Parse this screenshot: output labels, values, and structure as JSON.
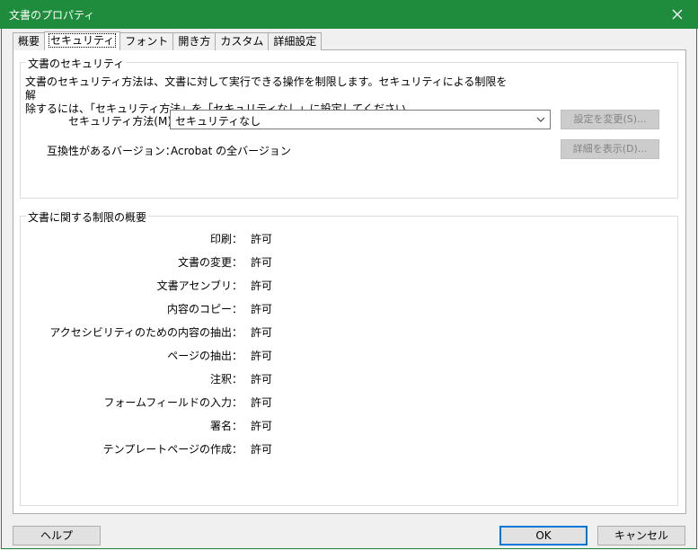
{
  "window": {
    "title": "文書のプロパティ"
  },
  "tabs": [
    {
      "label": "概要"
    },
    {
      "label": "セキュリティ",
      "active": true
    },
    {
      "label": "フォント"
    },
    {
      "label": "開き方"
    },
    {
      "label": "カスタム"
    },
    {
      "label": "詳細設定"
    }
  ],
  "security": {
    "group_title": "文書のセキュリティ",
    "description_line1": "文書のセキュリティ方法は、文書に対して実行できる操作を制限します。セキュリティによる制限を解",
    "description_line2": "除するには、「セキュリティ方法」を「セキュリティなし」に設定してください。",
    "method_label": "セキュリティ方法(M)：",
    "method_value": "セキュリティなし",
    "change_settings_button": "設定を変更(S)...",
    "compat_label": "互換性があるバージョン：",
    "compat_value": "Acrobat の全バージョン",
    "show_details_button": "詳細を表示(D)..."
  },
  "restrictions": {
    "group_title": "文書に関する制限の概要",
    "items": [
      {
        "label": "印刷：",
        "value": "許可"
      },
      {
        "label": "文書の変更：",
        "value": "許可"
      },
      {
        "label": "文書アセンブリ：",
        "value": "許可"
      },
      {
        "label": "内容のコピー：",
        "value": "許可"
      },
      {
        "label": "アクセシビリティのための内容の抽出：",
        "value": "許可"
      },
      {
        "label": "ページの抽出：",
        "value": "許可"
      },
      {
        "label": "注釈：",
        "value": "許可"
      },
      {
        "label": "フォームフィールドの入力：",
        "value": "許可"
      },
      {
        "label": "署名：",
        "value": "許可"
      },
      {
        "label": "テンプレートページの作成：",
        "value": "許可"
      }
    ]
  },
  "footer": {
    "help_button": "ヘルプ",
    "ok_button": "OK",
    "cancel_button": "キャンセル"
  },
  "colors": {
    "titlebar": "#1e8c3c",
    "default_button_border": "#0078d7",
    "disabled_button_bg": "#cccccc"
  }
}
